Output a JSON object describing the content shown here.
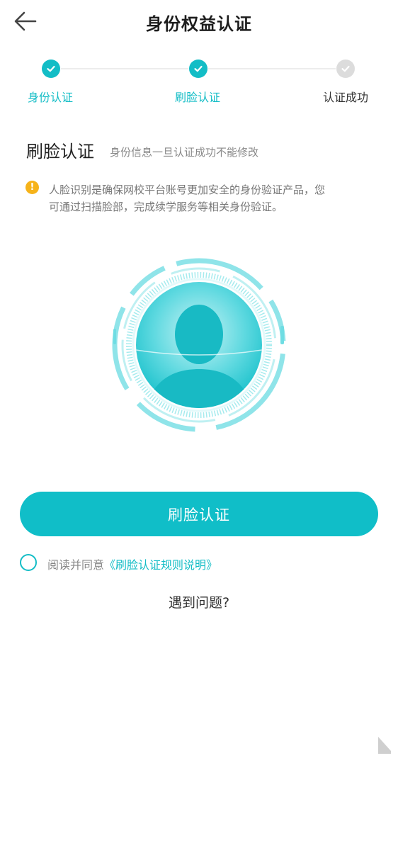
{
  "header": {
    "title": "身份权益认证"
  },
  "steps": [
    {
      "label": "身份认证",
      "status": "done"
    },
    {
      "label": "刷脸认证",
      "status": "done"
    },
    {
      "label": "认证成功",
      "status": "todo"
    }
  ],
  "section": {
    "title": "刷脸认证",
    "subtitle": "身份信息一旦认证成功不能修改"
  },
  "notice": {
    "icon": "warning-icon",
    "line1": "人脸识别是确保网校平台账号更加安全的身份验证产品，您",
    "line2": "可通过扫描脸部，完成续学服务等相关身份验证。"
  },
  "illustration": {
    "icon": "face-scan-icon"
  },
  "main_button": {
    "label": "刷脸认证"
  },
  "agreement": {
    "prefix": "阅读并同意",
    "link": "《刷脸认证规则说明》"
  },
  "help": {
    "label": "遇到问题?"
  },
  "colors": {
    "accent": "#13bdc6",
    "warning": "#f6b31a",
    "inactive": "#dcdcdc"
  }
}
